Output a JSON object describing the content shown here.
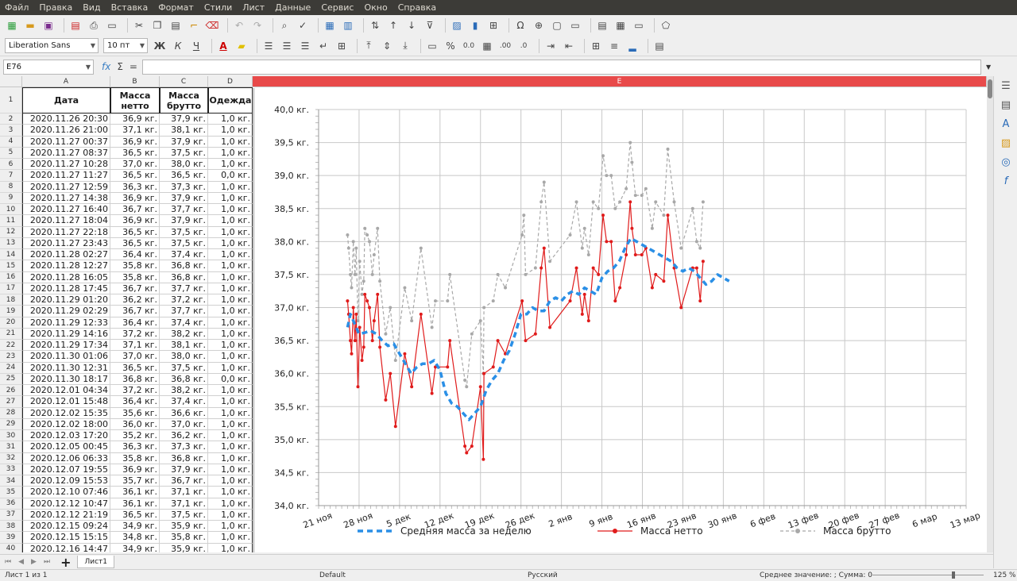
{
  "menu": [
    "Файл",
    "Правка",
    "Вид",
    "Вставка",
    "Формат",
    "Стили",
    "Лист",
    "Данные",
    "Сервис",
    "Окно",
    "Справка"
  ],
  "toolbar": {
    "font_name": "Liberation Sans",
    "font_size": "10 пт",
    "bold": "Ж",
    "italic": "К",
    "underline": "Ч",
    "percent": "%",
    "decimal": "0.0",
    "add_decimal": ".00",
    "del_decimal": ".0"
  },
  "formula_bar": {
    "cell_ref": "E76",
    "fx": "fx",
    "sigma": "Σ",
    "eq": "=",
    "value": ""
  },
  "columns": [
    {
      "id": "A",
      "label": "A"
    },
    {
      "id": "B",
      "label": "B"
    },
    {
      "id": "C",
      "label": "C"
    },
    {
      "id": "D",
      "label": "D"
    },
    {
      "id": "E",
      "label": "E"
    }
  ],
  "header_row": {
    "num": "1",
    "a": "Дата",
    "b": "Масса нетто",
    "c": "Масса брутто",
    "d": "Одежда"
  },
  "rows": [
    {
      "num": "2",
      "a": "2020.11.26 20:30",
      "b": "36,9 кг.",
      "c": "37,9 кг.",
      "d": "1,0 кг."
    },
    {
      "num": "3",
      "a": "2020.11.26 21:00",
      "b": "37,1 кг.",
      "c": "38,1 кг.",
      "d": "1,0 кг."
    },
    {
      "num": "4",
      "a": "2020.11.27 00:37",
      "b": "36,9 кг.",
      "c": "37,9 кг.",
      "d": "1,0 кг."
    },
    {
      "num": "5",
      "a": "2020.11.27 08:37",
      "b": "36,5 кг.",
      "c": "37,5 кг.",
      "d": "1,0 кг."
    },
    {
      "num": "6",
      "a": "2020.11.27 10:28",
      "b": "37,0 кг.",
      "c": "38,0 кг.",
      "d": "1,0 кг."
    },
    {
      "num": "7",
      "a": "2020.11.27 11:27",
      "b": "36,5 кг.",
      "c": "36,5 кг.",
      "d": "0,0 кг."
    },
    {
      "num": "8",
      "a": "2020.11.27 12:59",
      "b": "36,3 кг.",
      "c": "37,3 кг.",
      "d": "1,0 кг."
    },
    {
      "num": "9",
      "a": "2020.11.27 14:38",
      "b": "36,9 кг.",
      "c": "37,9 кг.",
      "d": "1,0 кг."
    },
    {
      "num": "10",
      "a": "2020.11.27 16:40",
      "b": "36,7 кг.",
      "c": "37,7 кг.",
      "d": "1,0 кг."
    },
    {
      "num": "11",
      "a": "2020.11.27 18:04",
      "b": "36,9 кг.",
      "c": "37,9 кг.",
      "d": "1,0 кг."
    },
    {
      "num": "12",
      "a": "2020.11.27 22:18",
      "b": "36,5 кг.",
      "c": "37,5 кг.",
      "d": "1,0 кг."
    },
    {
      "num": "13",
      "a": "2020.11.27 23:43",
      "b": "36,5 кг.",
      "c": "37,5 кг.",
      "d": "1,0 кг."
    },
    {
      "num": "14",
      "a": "2020.11.28 02:27",
      "b": "36,4 кг.",
      "c": "37,4 кг.",
      "d": "1,0 кг."
    },
    {
      "num": "15",
      "a": "2020.11.28 12:27",
      "b": "35,8 кг.",
      "c": "36,8 кг.",
      "d": "1,0 кг."
    },
    {
      "num": "16",
      "a": "2020.11.28 16:05",
      "b": "35,8 кг.",
      "c": "36,8 кг.",
      "d": "1,0 кг."
    },
    {
      "num": "17",
      "a": "2020.11.28 17:45",
      "b": "36,7 кг.",
      "c": "37,7 кг.",
      "d": "1,0 кг."
    },
    {
      "num": "18",
      "a": "2020.11.29 01:20",
      "b": "36,2 кг.",
      "c": "37,2 кг.",
      "d": "1,0 кг."
    },
    {
      "num": "19",
      "a": "2020.11.29 02:29",
      "b": "36,7 кг.",
      "c": "37,7 кг.",
      "d": "1,0 кг."
    },
    {
      "num": "20",
      "a": "2020.11.29 12:33",
      "b": "36,4 кг.",
      "c": "37,4 кг.",
      "d": "1,0 кг."
    },
    {
      "num": "21",
      "a": "2020.11.29 14:16",
      "b": "37,2 кг.",
      "c": "38,2 кг.",
      "d": "1,0 кг."
    },
    {
      "num": "22",
      "a": "2020.11.29 17:34",
      "b": "37,1 кг.",
      "c": "38,1 кг.",
      "d": "1,0 кг."
    },
    {
      "num": "23",
      "a": "2020.11.30 01:06",
      "b": "37,0 кг.",
      "c": "38,0 кг.",
      "d": "1,0 кг."
    },
    {
      "num": "24",
      "a": "2020.11.30 12:31",
      "b": "36,5 кг.",
      "c": "37,5 кг.",
      "d": "1,0 кг."
    },
    {
      "num": "25",
      "a": "2020.11.30 18:17",
      "b": "36,8 кг.",
      "c": "36,8 кг.",
      "d": "0,0 кг."
    },
    {
      "num": "26",
      "a": "2020.12.01 04:34",
      "b": "37,2 кг.",
      "c": "38,2 кг.",
      "d": "1,0 кг."
    },
    {
      "num": "27",
      "a": "2020.12.01 15:48",
      "b": "36,4 кг.",
      "c": "37,4 кг.",
      "d": "1,0 кг."
    },
    {
      "num": "28",
      "a": "2020.12.02 15:35",
      "b": "35,6 кг.",
      "c": "36,6 кг.",
      "d": "1,0 кг."
    },
    {
      "num": "29",
      "a": "2020.12.02 18:00",
      "b": "36,0 кг.",
      "c": "37,0 кг.",
      "d": "1,0 кг."
    },
    {
      "num": "30",
      "a": "2020.12.03 17:20",
      "b": "35,2 кг.",
      "c": "36,2 кг.",
      "d": "1,0 кг."
    },
    {
      "num": "31",
      "a": "2020.12.05 00:45",
      "b": "36,3 кг.",
      "c": "37,3 кг.",
      "d": "1,0 кг."
    },
    {
      "num": "32",
      "a": "2020.12.06 06:33",
      "b": "35,8 кг.",
      "c": "36,8 кг.",
      "d": "1,0 кг."
    },
    {
      "num": "33",
      "a": "2020.12.07 19:55",
      "b": "36,9 кг.",
      "c": "37,9 кг.",
      "d": "1,0 кг."
    },
    {
      "num": "34",
      "a": "2020.12.09 15:53",
      "b": "35,7 кг.",
      "c": "36,7 кг.",
      "d": "1,0 кг."
    },
    {
      "num": "35",
      "a": "2020.12.10 07:46",
      "b": "36,1 кг.",
      "c": "37,1 кг.",
      "d": "1,0 кг."
    },
    {
      "num": "36",
      "a": "2020.12.12 10:47",
      "b": "36,1 кг.",
      "c": "37,1 кг.",
      "d": "1,0 кг."
    },
    {
      "num": "37",
      "a": "2020.12.12 21:19",
      "b": "36,5 кг.",
      "c": "37,5 кг.",
      "d": "1,0 кг."
    },
    {
      "num": "38",
      "a": "2020.12.15 09:24",
      "b": "34,9 кг.",
      "c": "35,9 кг.",
      "d": "1,0 кг."
    },
    {
      "num": "39",
      "a": "2020.12.15 15:15",
      "b": "34,8 кг.",
      "c": "35,8 кг.",
      "d": "1,0 кг."
    },
    {
      "num": "40",
      "a": "2020.12.16 14:47",
      "b": "34,9 кг.",
      "c": "35,9 кг.",
      "d": "1,0 кг."
    }
  ],
  "chart_data": {
    "type": "line",
    "y_labels": [
      "34,0 кг.",
      "34,5 кг.",
      "35,0 кг.",
      "35,5 кг.",
      "36,0 кг.",
      "36,5 кг.",
      "37,0 кг.",
      "37,5 кг.",
      "38,0 кг.",
      "38,5 кг.",
      "39,0 кг.",
      "39,5 кг.",
      "40,0 кг."
    ],
    "x_labels": [
      "21 ноя",
      "28 ноя",
      "5 дек",
      "12 дек",
      "19 дек",
      "26 дек",
      "2 янв",
      "9 янв",
      "16 янв",
      "23 янв",
      "30 янв",
      "6 фев",
      "13 фев",
      "20 фев",
      "27 фев",
      "6 мар",
      "13 мар"
    ],
    "ylim": [
      34,
      40
    ],
    "x_range_days": [
      0,
      112
    ],
    "x_origin_label": "21 ноя",
    "grid": true,
    "legend_position": "bottom",
    "series": [
      {
        "name": "Средняя масса за неделю",
        "color": "#2a8fe6",
        "style": "dashed-thick",
        "points": [
          [
            5,
            36.7
          ],
          [
            5.5,
            36.9
          ],
          [
            6,
            36.8
          ],
          [
            7,
            36.6
          ],
          [
            8,
            36.62
          ],
          [
            9,
            36.65
          ],
          [
            10,
            36.6
          ],
          [
            11,
            36.5
          ],
          [
            12,
            36.42
          ],
          [
            13,
            36.45
          ],
          [
            14,
            36.3
          ],
          [
            15,
            36.15
          ],
          [
            16,
            36.0
          ],
          [
            17,
            36.1
          ],
          [
            18,
            36.15
          ],
          [
            19,
            36.15
          ],
          [
            20,
            36.2
          ],
          [
            21,
            36.05
          ],
          [
            22,
            35.7
          ],
          [
            23,
            35.55
          ],
          [
            24,
            35.5
          ],
          [
            25,
            35.4
          ],
          [
            26,
            35.3
          ],
          [
            27,
            35.4
          ],
          [
            28,
            35.5
          ],
          [
            29,
            35.75
          ],
          [
            30,
            35.9
          ],
          [
            31,
            36.0
          ],
          [
            32,
            36.2
          ],
          [
            33,
            36.35
          ],
          [
            34,
            36.6
          ],
          [
            35,
            36.9
          ],
          [
            36,
            36.9
          ],
          [
            37,
            37.0
          ],
          [
            38,
            36.95
          ],
          [
            39,
            36.95
          ],
          [
            40,
            37.1
          ],
          [
            41,
            37.15
          ],
          [
            42,
            37.1
          ],
          [
            43,
            37.2
          ],
          [
            44,
            37.25
          ],
          [
            45,
            37.2
          ],
          [
            46,
            37.3
          ],
          [
            47,
            37.25
          ],
          [
            48,
            37.2
          ],
          [
            49,
            37.45
          ],
          [
            50,
            37.55
          ],
          [
            51,
            37.6
          ],
          [
            52,
            37.7
          ],
          [
            53,
            37.9
          ],
          [
            54,
            38.05
          ],
          [
            55,
            38.0
          ],
          [
            56,
            37.95
          ],
          [
            57,
            37.9
          ],
          [
            58,
            37.85
          ],
          [
            59,
            37.8
          ],
          [
            60,
            37.75
          ],
          [
            61,
            37.7
          ],
          [
            62,
            37.6
          ],
          [
            63,
            37.55
          ],
          [
            64,
            37.6
          ],
          [
            65,
            37.55
          ],
          [
            66,
            37.45
          ],
          [
            67,
            37.35
          ],
          [
            68,
            37.4
          ],
          [
            69,
            37.5
          ],
          [
            70,
            37.45
          ],
          [
            71,
            37.4
          ]
        ]
      },
      {
        "name": "Масса нетто",
        "color": "#e01b1b",
        "style": "solid-marker",
        "points": [
          [
            5,
            37.1
          ],
          [
            5.2,
            36.9
          ],
          [
            5.5,
            36.5
          ],
          [
            5.7,
            36.3
          ],
          [
            6,
            37.0
          ],
          [
            6.3,
            36.5
          ],
          [
            6.5,
            36.9
          ],
          [
            6.8,
            35.8
          ],
          [
            7.1,
            36.7
          ],
          [
            7.5,
            36.2
          ],
          [
            7.8,
            36.4
          ],
          [
            8,
            37.2
          ],
          [
            8.4,
            37.1
          ],
          [
            8.8,
            37.0
          ],
          [
            9.3,
            36.5
          ],
          [
            9.6,
            36.8
          ],
          [
            10.2,
            37.2
          ],
          [
            10.6,
            36.4
          ],
          [
            11.6,
            35.6
          ],
          [
            12.4,
            36.0
          ],
          [
            13.3,
            35.2
          ],
          [
            14.9,
            36.3
          ],
          [
            16.1,
            35.8
          ],
          [
            17.7,
            36.9
          ],
          [
            19.6,
            35.7
          ],
          [
            20.2,
            36.1
          ],
          [
            22.3,
            36.1
          ],
          [
            22.7,
            36.5
          ],
          [
            25.3,
            34.9
          ],
          [
            25.6,
            34.8
          ],
          [
            26.5,
            34.9
          ],
          [
            28.0,
            35.8
          ],
          [
            28.5,
            34.7
          ],
          [
            28.6,
            36.0
          ],
          [
            30.2,
            36.1
          ],
          [
            31.0,
            36.5
          ],
          [
            32.3,
            36.3
          ],
          [
            35.2,
            37.1
          ],
          [
            35.8,
            36.5
          ],
          [
            37.5,
            36.6
          ],
          [
            38.5,
            37.6
          ],
          [
            39.0,
            37.9
          ],
          [
            40.0,
            36.7
          ],
          [
            43.5,
            37.1
          ],
          [
            44.6,
            37.6
          ],
          [
            45.6,
            36.9
          ],
          [
            46.0,
            37.2
          ],
          [
            46.7,
            36.8
          ],
          [
            47.5,
            37.6
          ],
          [
            48.4,
            37.5
          ],
          [
            49.2,
            38.4
          ],
          [
            49.8,
            38.0
          ],
          [
            50.6,
            38.0
          ],
          [
            51.3,
            37.1
          ],
          [
            52.1,
            37.3
          ],
          [
            53.2,
            37.8
          ],
          [
            53.9,
            38.6
          ],
          [
            54.2,
            38.2
          ],
          [
            54.8,
            37.8
          ],
          [
            55.9,
            37.8
          ],
          [
            56.6,
            37.9
          ],
          [
            57.7,
            37.3
          ],
          [
            58.3,
            37.5
          ],
          [
            59.7,
            37.4
          ],
          [
            60.4,
            38.4
          ],
          [
            61.5,
            37.6
          ],
          [
            62.7,
            37.0
          ],
          [
            64.7,
            37.6
          ],
          [
            65.4,
            37.6
          ],
          [
            66.0,
            37.1
          ],
          [
            66.5,
            37.7
          ]
        ]
      },
      {
        "name": "Масса брутто",
        "color": "#a8a8a8",
        "style": "dashed-marker",
        "points": [
          [
            5,
            38.1
          ],
          [
            5.2,
            37.9
          ],
          [
            5.5,
            37.5
          ],
          [
            5.7,
            37.3
          ],
          [
            6,
            38.0
          ],
          [
            6.3,
            37.5
          ],
          [
            6.5,
            37.9
          ],
          [
            6.8,
            36.8
          ],
          [
            7.1,
            37.7
          ],
          [
            7.5,
            37.2
          ],
          [
            7.8,
            37.4
          ],
          [
            8,
            38.2
          ],
          [
            8.4,
            38.1
          ],
          [
            8.8,
            38.0
          ],
          [
            9.3,
            37.5
          ],
          [
            9.6,
            37.8
          ],
          [
            10.2,
            38.2
          ],
          [
            10.6,
            37.4
          ],
          [
            11.6,
            36.6
          ],
          [
            12.4,
            37.0
          ],
          [
            13.3,
            36.2
          ],
          [
            14.9,
            37.3
          ],
          [
            16.1,
            36.8
          ],
          [
            17.7,
            37.9
          ],
          [
            19.6,
            36.7
          ],
          [
            20.2,
            37.1
          ],
          [
            22.3,
            37.1
          ],
          [
            22.7,
            37.5
          ],
          [
            25.3,
            35.9
          ],
          [
            25.6,
            35.8
          ],
          [
            26.5,
            36.6
          ],
          [
            28.0,
            36.8
          ],
          [
            28.5,
            36.0
          ],
          [
            28.6,
            37.0
          ],
          [
            30.2,
            37.1
          ],
          [
            31.0,
            37.5
          ],
          [
            32.3,
            37.3
          ],
          [
            35.2,
            38.1
          ],
          [
            35.5,
            38.4
          ],
          [
            35.8,
            37.5
          ],
          [
            37.5,
            37.6
          ],
          [
            38.5,
            38.6
          ],
          [
            39.0,
            38.9
          ],
          [
            40.0,
            37.7
          ],
          [
            43.5,
            38.1
          ],
          [
            44.6,
            38.6
          ],
          [
            45.6,
            37.9
          ],
          [
            46.0,
            38.2
          ],
          [
            46.7,
            37.8
          ],
          [
            47.5,
            38.6
          ],
          [
            48.4,
            38.5
          ],
          [
            49.2,
            39.3
          ],
          [
            49.8,
            39.0
          ],
          [
            50.6,
            39.0
          ],
          [
            51.3,
            38.5
          ],
          [
            52.1,
            38.6
          ],
          [
            53.2,
            38.8
          ],
          [
            53.9,
            39.5
          ],
          [
            54.2,
            39.2
          ],
          [
            54.8,
            38.7
          ],
          [
            55.9,
            38.7
          ],
          [
            56.6,
            38.8
          ],
          [
            57.7,
            38.2
          ],
          [
            58.3,
            38.6
          ],
          [
            59.7,
            38.4
          ],
          [
            60.4,
            39.4
          ],
          [
            61.5,
            38.6
          ],
          [
            62.7,
            37.9
          ],
          [
            64.7,
            38.5
          ],
          [
            65.4,
            38.0
          ],
          [
            66.0,
            37.9
          ],
          [
            66.5,
            38.6
          ]
        ]
      }
    ]
  },
  "sheet_tab": {
    "label": "Лист1",
    "add": "+"
  },
  "nav_arrows": [
    "⏮",
    "◀",
    "▶",
    "⏭"
  ],
  "status": {
    "sheet": "Лист 1 из 1",
    "style": "Default",
    "language": "Русский",
    "summary": "Среднее значение: ; Сумма: 0",
    "zoom": "125 %"
  }
}
